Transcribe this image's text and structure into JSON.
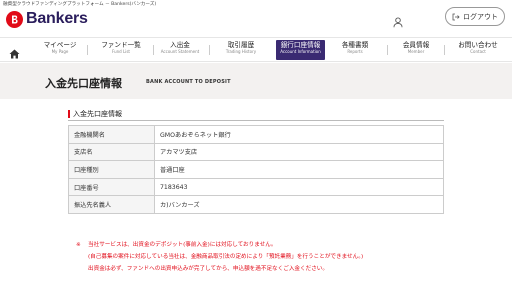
{
  "header": {
    "tagline": "融資型クラウドファンディングプラットフォーム － Bankers(バンカーズ)",
    "logo_text": "Bankers",
    "login_label": "ログアウト"
  },
  "nav": {
    "items": [
      {
        "ja": "マイページ",
        "en": "My Page"
      },
      {
        "ja": "ファンド一覧",
        "en": "Fund List"
      },
      {
        "ja": "入出金",
        "en": "Account Statement"
      },
      {
        "ja": "取引履歴",
        "en": "Trading History"
      },
      {
        "ja": "銀行口座情報",
        "en": "Account Information"
      },
      {
        "ja": "各種書類",
        "en": "Reports"
      },
      {
        "ja": "会員情報",
        "en": "Member"
      },
      {
        "ja": "お問い合わせ",
        "en": "Contact"
      }
    ]
  },
  "page": {
    "title": "入金先口座情報",
    "subtitle": "BANK ACCOUNT TO DEPOSIT",
    "section_title": "入金先口座情報"
  },
  "account_table": {
    "rows": [
      {
        "label": "金融機関名",
        "value": "GMOあおぞらネット銀行"
      },
      {
        "label": "支店名",
        "value": "アカマツ支店"
      },
      {
        "label": "口座種別",
        "value": "普通口座"
      },
      {
        "label": "口座番号",
        "value": "7183643"
      },
      {
        "label": "振込先名義人",
        "value": "カ)バンカーズ"
      }
    ]
  },
  "notes": {
    "mark": "※",
    "line1": "当社サービスは、出資金のデポジット(事前入金)には対応しておりません。",
    "line2": "(自己募集の案件に対応している当社は、金融商品取引法の定めにより「預託業務」を行うことができません。)",
    "line3": "出資金は必ず、ファンドへの出資申込みが完了してから、申込額を過不足なくご入金ください。"
  },
  "colors": {
    "brand_red": "#e10b18",
    "nav_active": "#3a2a72",
    "banner_bg": "#f3f1f0"
  },
  "icons": [
    "bankers-logo-icon",
    "user-icon",
    "logout-icon",
    "home-icon"
  ]
}
